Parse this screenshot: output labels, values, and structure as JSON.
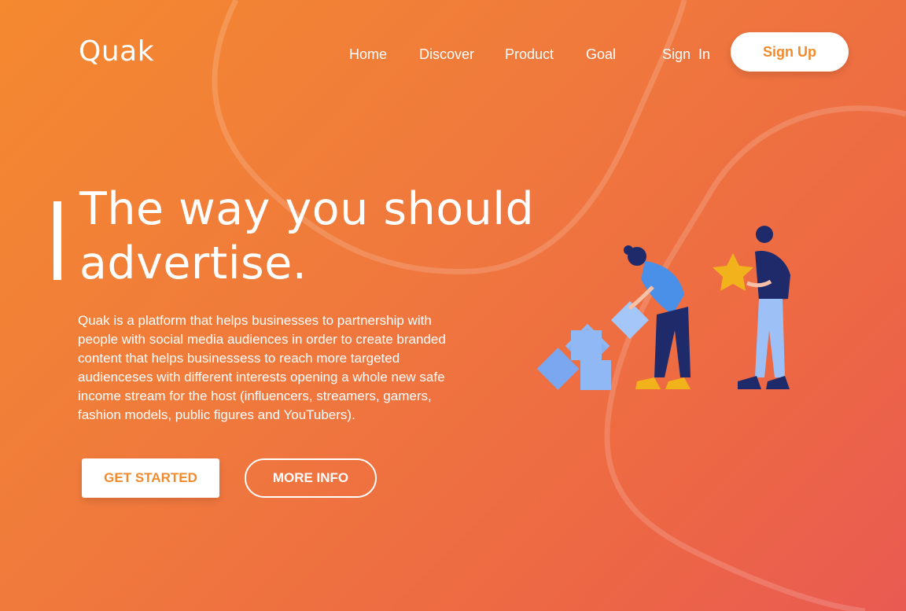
{
  "brand": {
    "logo": "Quak"
  },
  "nav": {
    "items": [
      "Home",
      "Discover",
      "Product",
      "Goal"
    ],
    "sign_in": "Sign  In",
    "sign_up": "Sign Up"
  },
  "hero": {
    "headline_line1": "The way you should",
    "headline_line2": "advertise.",
    "description": "Quak is a platform that helps businesses to partnership with people with social media audiences in order to create branded content that helps businessess to reach more targeted audienceses with different interests opening a whole new safe income stream for the host (influencers, streamers, gamers, fashion models, public figures and YouTubers).",
    "primary_cta": "GET STARTED",
    "secondary_cta": "MORE INFO"
  },
  "illustration": {
    "icons": [
      "box-icon",
      "star-icon"
    ],
    "subjects": [
      "person-stacking-boxes",
      "person-holding-star"
    ]
  },
  "colors": {
    "gradient_start": "#f4892f",
    "gradient_end": "#e95a52",
    "accent_text": "#f28a2c",
    "box_blue": "#8fb8f5",
    "star_yellow": "#f2b21c",
    "navy": "#1f2a6b"
  }
}
